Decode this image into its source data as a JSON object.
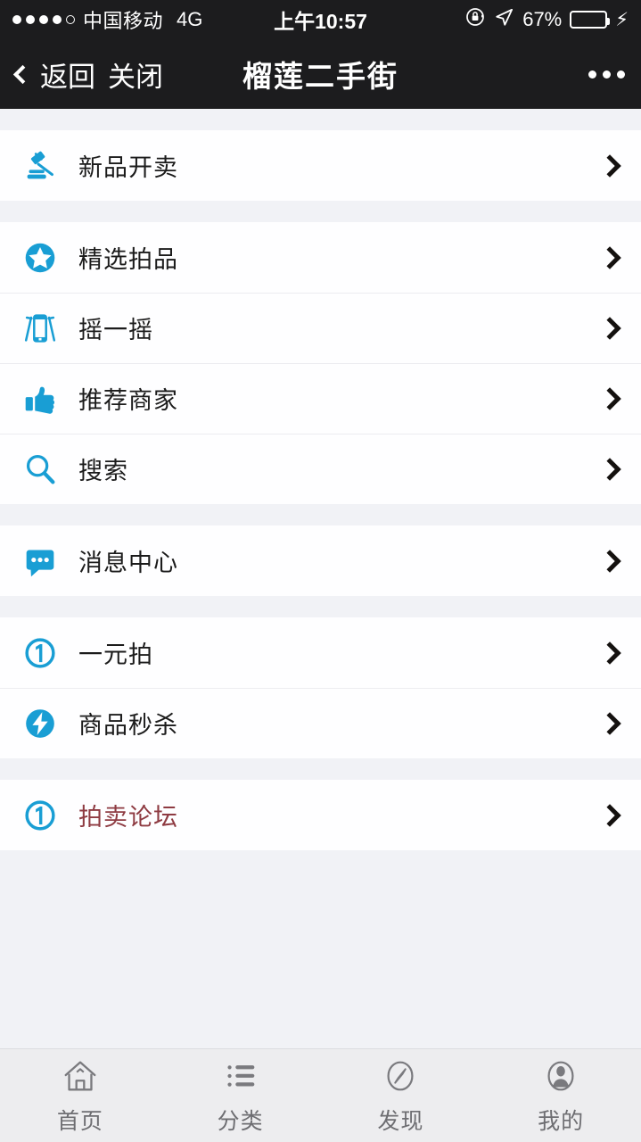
{
  "status_bar": {
    "signal_dots_total": 5,
    "signal_dots_filled": 4,
    "carrier": "中国移动",
    "network": "4G",
    "time": "上午10:57",
    "battery_percent": "67%",
    "battery_level": 67,
    "rotation_lock_icon": "rotation-lock-icon",
    "location_icon": "location-arrow-icon",
    "charging_icon": "charging-bolt-icon",
    "background_color": "#1c1c1e"
  },
  "nav_bar": {
    "back_label": "返回",
    "close_label": "关闭",
    "title": "榴莲二手街",
    "more_icon": "more-dots-icon",
    "background_color": "#1c1c1e"
  },
  "theme": {
    "icon_blue": "#199ed4",
    "accent_red": "#8e3b42",
    "page_background": "#f1f2f6",
    "row_background": "#fefeff",
    "divider": "#ececf0"
  },
  "sections": [
    {
      "rows": [
        {
          "icon": "gavel-icon",
          "label": "新品开卖",
          "chevron": "chevron-right-icon",
          "highlight": false
        }
      ]
    },
    {
      "rows": [
        {
          "icon": "star-circle-icon",
          "label": "精选拍品",
          "chevron": "chevron-right-icon",
          "highlight": false
        },
        {
          "icon": "shake-phone-icon",
          "label": "摇一摇",
          "chevron": "chevron-right-icon",
          "highlight": false
        },
        {
          "icon": "thumbs-up-icon",
          "label": "推荐商家",
          "chevron": "chevron-right-icon",
          "highlight": false
        },
        {
          "icon": "search-icon",
          "label": "搜索",
          "chevron": "chevron-right-icon",
          "highlight": false
        }
      ]
    },
    {
      "rows": [
        {
          "icon": "message-bubble-icon",
          "label": "消息中心",
          "chevron": "chevron-right-icon",
          "highlight": false
        }
      ]
    },
    {
      "rows": [
        {
          "icon": "one-coin-icon",
          "label": "一元拍",
          "chevron": "chevron-right-icon",
          "highlight": false
        },
        {
          "icon": "lightning-circle-icon",
          "label": "商品秒杀",
          "chevron": "chevron-right-icon",
          "highlight": false
        }
      ]
    },
    {
      "rows": [
        {
          "icon": "one-coin-icon",
          "label": "拍卖论坛",
          "chevron": "chevron-right-icon",
          "highlight": true
        }
      ]
    }
  ],
  "tab_bar": {
    "background_color": "#ededef",
    "tabs": [
      {
        "icon": "home-icon",
        "label": "首页",
        "active": false
      },
      {
        "icon": "category-list-icon",
        "label": "分类",
        "active": false
      },
      {
        "icon": "compass-icon",
        "label": "发现",
        "active": false
      },
      {
        "icon": "person-icon",
        "label": "我的",
        "active": false
      }
    ]
  }
}
